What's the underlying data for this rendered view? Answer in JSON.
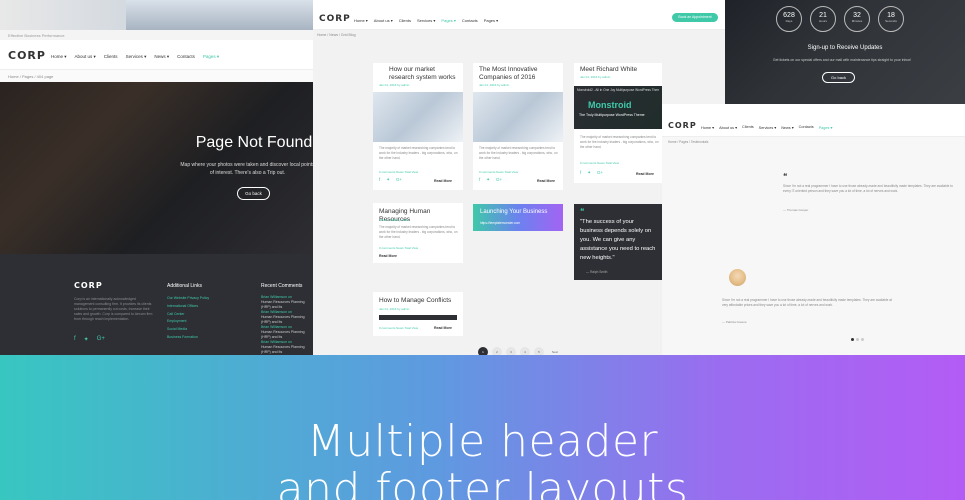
{
  "banner": {
    "line1": "Multiple header",
    "line2": "and footer layouts"
  },
  "left": {
    "topstrip": "Effective Business Performance",
    "logo": "CORP",
    "nav": [
      "Home ▾",
      "About us ▾",
      "Clients",
      "Services ▾",
      "News ▾",
      "Contacts",
      "Pages ▾"
    ],
    "crumbs": "Home / Pages / 404 page",
    "hero_title": "Page Not Found",
    "hero_text": "Map where your photos were taken and discover local points of interest. There's also a Trip out.",
    "go_back": "Go back",
    "footer": {
      "logo": "CORP",
      "about": "Corp is an internationally acknowledged management consulting firm. It provides its clients solutions to permanently cut costs, increase their sales and growth. Corp is compared to Aecom firm from through reach implementation.",
      "links_title": "Additional Links",
      "links": [
        "Our Website Privacy Policy",
        "International Offices",
        "Call Center",
        "Employment",
        "Social Media",
        "Business Formation"
      ],
      "comments_title": "Recent Comments",
      "comments": [
        {
          "who": "Brian Williamson on",
          "what": "Human Resources Planning (HRP) and Its"
        },
        {
          "who": "Brian Williamson on",
          "what": "Human Resources Planning (HRP) and Its"
        },
        {
          "who": "Brian Williamson on",
          "what": "Human Resources Planning (HRP) and Its"
        },
        {
          "who": "Brian Williamson on",
          "what": "Human Resources Planning (HRP) and Its"
        }
      ]
    }
  },
  "mid": {
    "logo": "CORP",
    "nav": [
      "Home ▾",
      "About us ▾",
      "Clients",
      "Services ▾",
      "Pages ▾",
      "Contacts",
      "Pages ▾"
    ],
    "appointment": "Book an Appointment",
    "crumbs": "Home / News / Grid Blog",
    "cards": [
      {
        "title": "How our market research system works",
        "meta": "Jan 01, 2016   by admin",
        "text": "The majority of market researching companies tend to work for the industry leaders - big corporations, who, on the other hand,",
        "foot": "0 comments   News   Total View",
        "more": "Read More"
      },
      {
        "title": "The Most Innovative Companies of 2016",
        "meta": "Jan 01, 2016   by admin",
        "text": "The majority of market researching companies tend to work for the industry leaders - big corporations, who, on the other hand,",
        "foot": "0 comments   News   Total View",
        "more": "Read More"
      },
      {
        "title": "Meet Richard White",
        "meta": "Jan 01, 2016   by admin",
        "text": "The majority of market researching companies tend to work for the industry leaders - big corporations, who, on the other hand,",
        "foot": "0 comments   News   Total View",
        "more": "Read More"
      },
      {
        "title": "Managing Human Resources",
        "meta": "Jan 01, 2016   by admin",
        "text": "The majority of market researching companies tend to work for the industry leaders - big corporations, who, on the other hand,",
        "foot": "0 comments   News   Total View",
        "more": "Read More"
      },
      {
        "title": "How to Manage Conflicts",
        "meta": "Jan 01, 2016   by admin",
        "foot": "0 comments   News   Total View",
        "more": "Read More"
      }
    ],
    "video": {
      "bar": "Monstroid2 - All in One Joy Multipurpose WordPress Theme",
      "brand": "Monstroid",
      "sub": "The Truly Multipurpose WordPress Theme"
    },
    "launch": {
      "title": "Launching Your Business",
      "link": "https://templatemonster.com"
    },
    "quote": "\"The success of your business depends solely on you. We can give any assistance you need to reach new heights.\"",
    "quote_author": "— Ralph Smith",
    "pager": [
      "1",
      "2",
      "3",
      "4",
      "5",
      "Next"
    ]
  },
  "right_top": {
    "counts": [
      {
        "n": "628",
        "u": "Days"
      },
      {
        "n": "21",
        "u": "Hours"
      },
      {
        "n": "32",
        "u": "Minutes"
      },
      {
        "n": "18",
        "u": "Seconds"
      }
    ],
    "signup": "Sign-up to Receive Updates",
    "signup_text": "Get tickets on our special offers and our mail with maintenance tips straight to your inbox!",
    "go_back": "Go back"
  },
  "right": {
    "logo": "CORP",
    "nav": [
      "Home ▾",
      "About us ▾",
      "Clients",
      "Services ▾",
      "News ▾",
      "Contacts",
      "Pages ▾"
    ],
    "crumbs": "Home / Pages / Testimonials",
    "t1": {
      "text": "Since I'm not a real programmer I have to use those already-made and beautifully made templates. They are available to every IT-oriented person and they save you a lot of time, a lot of nerves and work.",
      "name": "— Thomas Cooper"
    },
    "t2": {
      "text": "Since I'm not a real programmer I have to use those already-made and beautifully made templates. They are available at very affordable prices and they save you a lot of time, a lot of nerves and work.",
      "name": "— Patricia Greene"
    }
  }
}
